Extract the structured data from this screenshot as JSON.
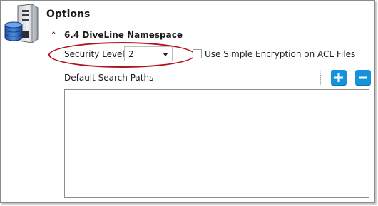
{
  "window": {
    "title": "Options"
  },
  "section": {
    "toggle_glyph": "⌃",
    "title": "6.4 DiveLine Namespace"
  },
  "security": {
    "label": "Security Level",
    "value": "2"
  },
  "encryption": {
    "label": "Use Simple Encryption on ACL Files",
    "checked": false
  },
  "search_paths": {
    "label": "Default Search Paths",
    "items": []
  },
  "colors": {
    "accent": "#1592d9",
    "highlight": "#b0131b"
  },
  "icons": {
    "app": "server-database-icon",
    "add": "plus-icon",
    "remove": "minus-icon",
    "dropdown": "chevron-down-icon"
  }
}
